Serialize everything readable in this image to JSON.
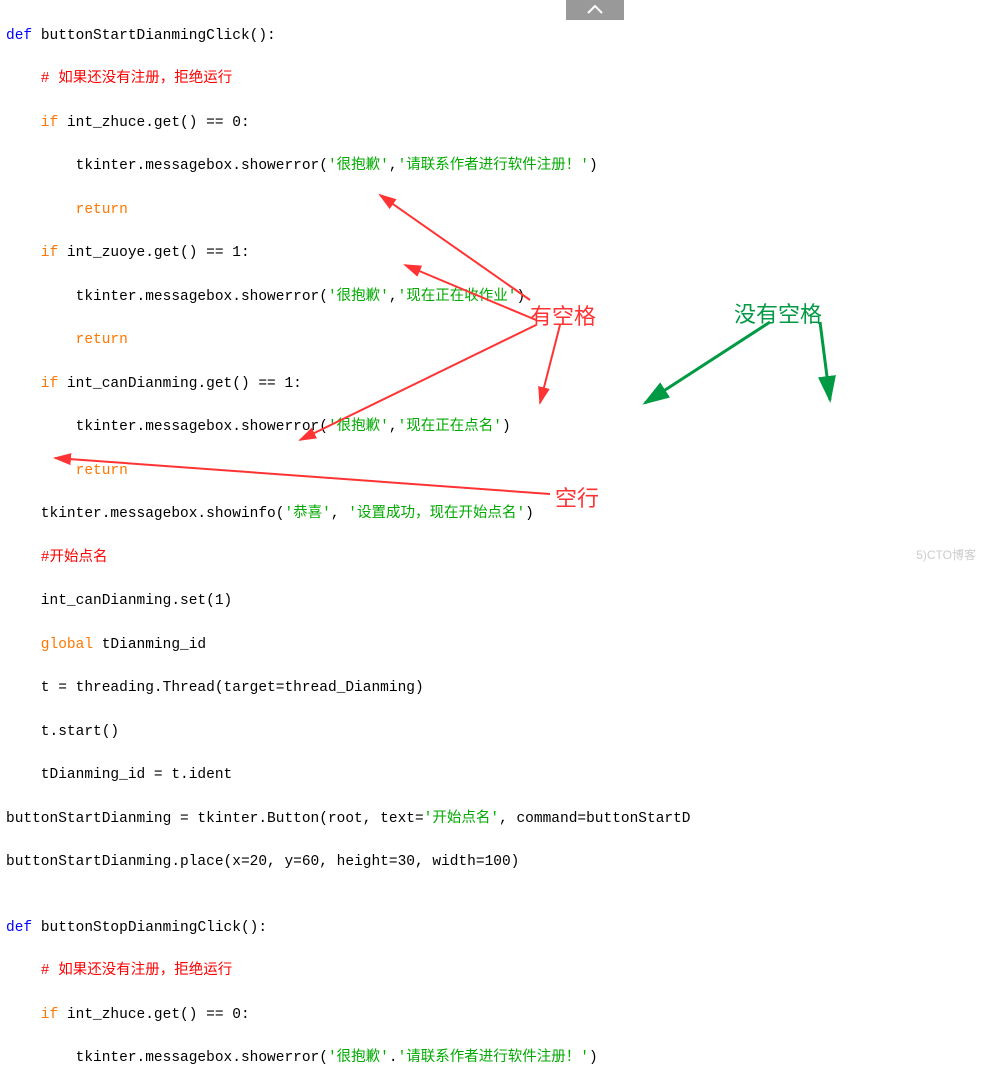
{
  "top_button": {
    "icon": "chevron-up"
  },
  "code": {
    "l1_def": "def ",
    "l1_name": "buttonStartDianmingClick():",
    "l2_comment": "    # 如果还没有注册，拒绝运行",
    "l3_if": "    if ",
    "l3_rest": "int_zhuce.get() == 0:",
    "l4_pre": "        tkinter.messagebox.showerror(",
    "l4_s1": "'很抱歉'",
    "l4_mid": ",",
    "l4_s2": "'请联系作者进行软件注册！'",
    "l4_post": ")",
    "l5_return": "        return",
    "l6_if": "    if ",
    "l6_rest": "int_zuoye.get() == 1:",
    "l7_pre": "        tkinter.messagebox.showerror(",
    "l7_s1": "'很抱歉'",
    "l7_mid": ",",
    "l7_s2": "'现在正在收作业'",
    "l7_post": ")",
    "l8_return": "        return",
    "l9_if": "    if ",
    "l9_rest": "int_canDianming.get() == 1:",
    "l10_pre": "        tkinter.messagebox.showerror(",
    "l10_s1": "'很抱歉'",
    "l10_mid": ",",
    "l10_s2": "'现在正在点名'",
    "l10_post": ")",
    "l11_return": "        return",
    "l12_pre": "    tkinter.messagebox.showinfo(",
    "l12_s1": "'恭喜'",
    "l12_mid": ", ",
    "l12_s2": "'设置成功，现在开始点名'",
    "l12_post": ")",
    "l13_comment": "    #开始点名",
    "l14": "    int_canDianming.set(1)",
    "l15_global": "    global ",
    "l15_rest": "tDianming_id",
    "l16": "    t = threading.Thread(target=thread_Dianming)",
    "l17": "    t.start()",
    "l18": "    tDianming_id = t.ident",
    "l19_pre": "buttonStartDianming = tkinter.Button(root, text=",
    "l19_s": "'开始点名'",
    "l19_post": ", command=buttonStartD",
    "l20": "buttonStartDianming.place(x=20, y=60, height=30, width=100)",
    "l21": "",
    "l22_def": "def ",
    "l22_name": "buttonStopDianmingClick():",
    "l23_comment": "    # 如果还没有注册，拒绝运行",
    "l24_if": "    if ",
    "l24_rest": "int_zhuce.get() == 0:",
    "l25_pre": "        tkinter.messagebox.showerror(",
    "l25_s1": "'很抱歉'",
    "l25_mid": ".",
    "l25_s2": "'请联系作者进行软件注册！'",
    "l25_post": ")"
  },
  "annotations": {
    "with_space": "有空格",
    "no_space": "没有空格",
    "blank_line": "空行"
  },
  "watermark": "5)CTO博客"
}
